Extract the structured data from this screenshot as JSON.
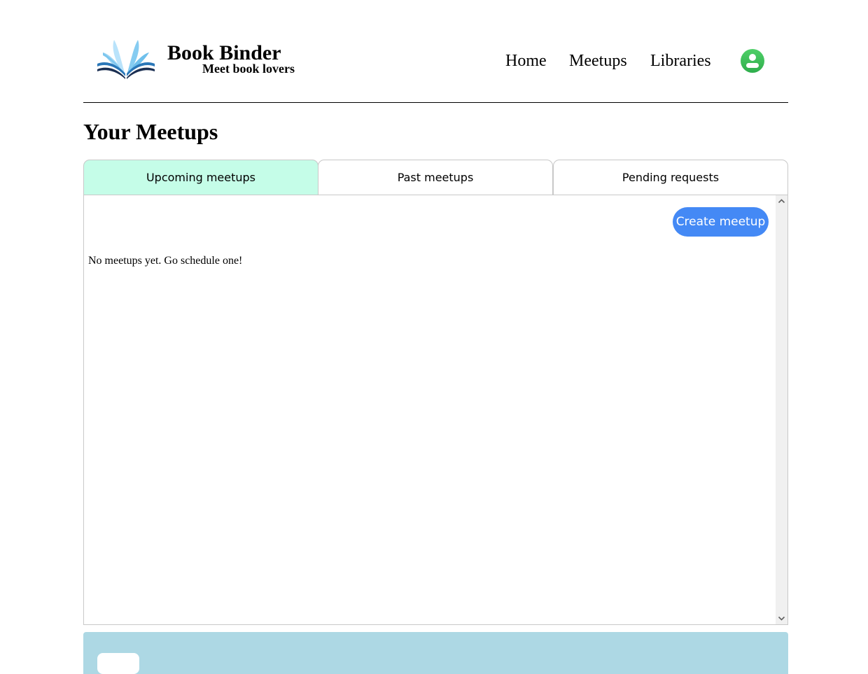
{
  "header": {
    "logo_icon": "open-book-icon",
    "brand_title": "Book Binder",
    "brand_subtitle": "Meet book lovers",
    "nav": {
      "home": "Home",
      "meetups": "Meetups",
      "libraries": "Libraries"
    },
    "profile_icon": "user-avatar-icon",
    "profile_color": "#3cbf5a"
  },
  "page_title": "Your Meetups",
  "tabs": [
    {
      "label": "Upcoming meetups",
      "active": true
    },
    {
      "label": "Past meetups",
      "active": false
    },
    {
      "label": "Pending requests",
      "active": false
    }
  ],
  "panel": {
    "create_button_label": "Create meetup",
    "empty_message": "No meetups yet. Go schedule one!"
  },
  "colors": {
    "active_tab": "#c5fde8",
    "primary_button": "#4489f5",
    "footer_bg": "#add8e4"
  }
}
